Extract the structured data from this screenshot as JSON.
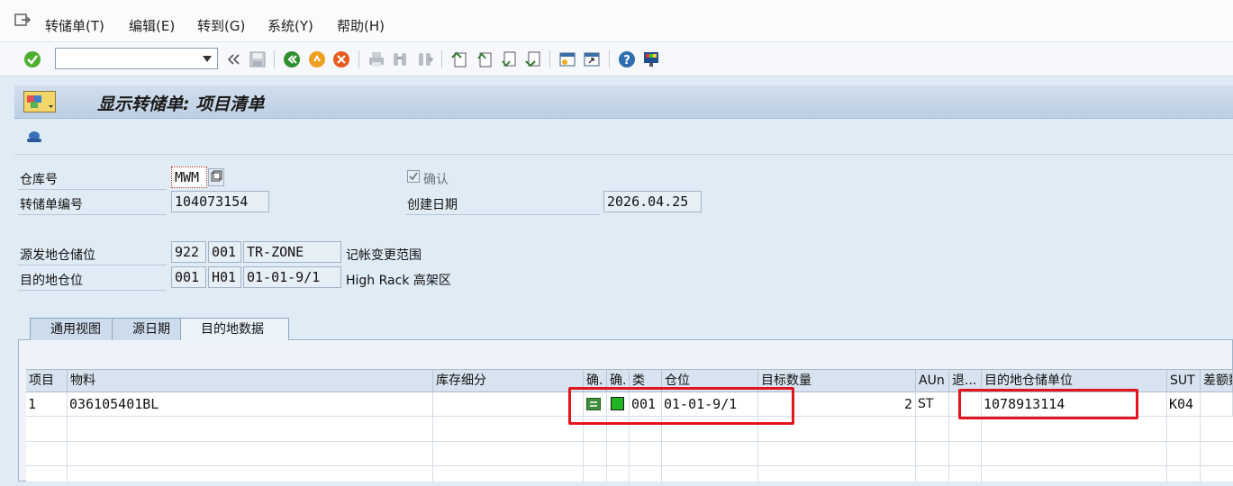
{
  "menu": {
    "items": [
      "转储单(T)",
      "编辑(E)",
      "转到(G)",
      "系统(Y)",
      "帮助(H)"
    ]
  },
  "toolbar": {
    "command_value": ""
  },
  "title": "显示转储单: 项目清单",
  "header": {
    "warehouse_label": "仓库号",
    "warehouse_value": "MWM",
    "confirm_label": "确认",
    "confirm_checked": true,
    "to_number_label": "转储单编号",
    "to_number_value": "104073154",
    "created_label": "创建日期",
    "created_value": "2026.04.25",
    "source_label": "源发地仓储位",
    "source_type": "922",
    "source_section": "001",
    "source_bin": "TR-ZONE",
    "source_desc": "记帐变更范围",
    "dest_label": "目的地仓位",
    "dest_type": "001",
    "dest_section": "H01",
    "dest_bin": "01-01-9/1",
    "dest_desc": "High Rack 高架区"
  },
  "tabs": [
    {
      "label": "通用视图",
      "active": false
    },
    {
      "label": "源日期",
      "active": false
    },
    {
      "label": "目的地数据",
      "active": true
    }
  ],
  "table": {
    "columns": [
      "项目",
      "物料",
      "库存细分",
      "确.",
      "确.",
      "类",
      "仓位",
      "目标数量",
      "AUn",
      "退...",
      "目的地仓储单位",
      "SUT",
      "差额数"
    ],
    "rows": [
      {
        "item": "1",
        "material": "036105401BL",
        "stock_split": "",
        "confirm1": "green-square-icon",
        "confirm2": "green-light-icon",
        "type": "001",
        "bin": "01-01-9/1",
        "target_qty": "2",
        "aun": "ST",
        "ret": "",
        "dest_su": "1078913114",
        "sut": "K04",
        "diff": ""
      }
    ]
  },
  "colors": {
    "highlight": "#e3141e",
    "status_green": "#22b422"
  }
}
